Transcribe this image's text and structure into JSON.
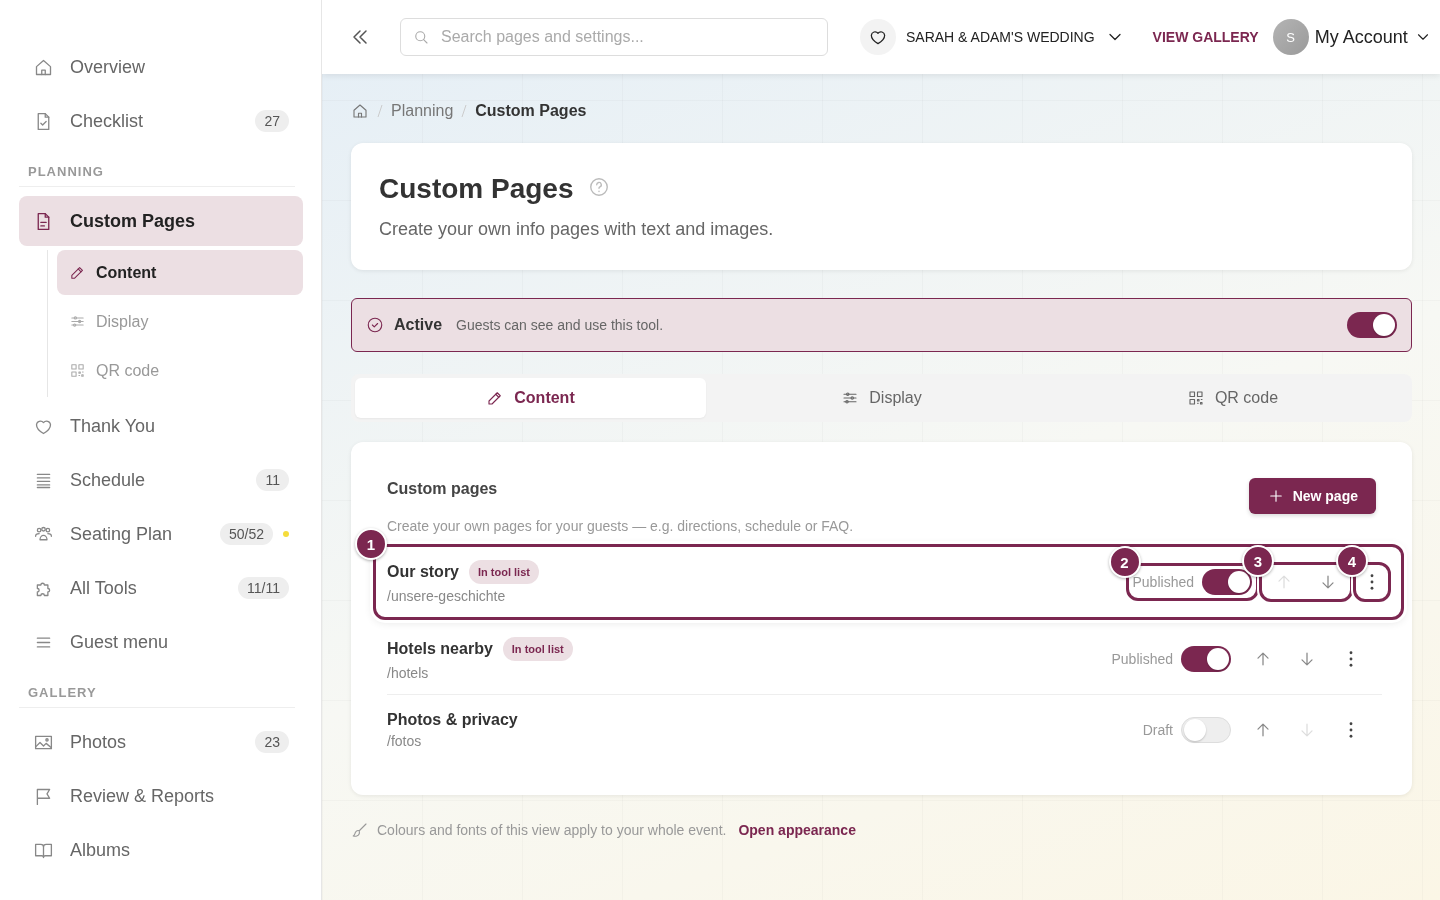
{
  "sidebar": {
    "sections": [
      {
        "items": [
          {
            "label": "Overview",
            "selected": false
          },
          {
            "label": "Checklist",
            "badge": "27",
            "selected": false
          }
        ]
      },
      {
        "heading": "PLANNING",
        "items": [
          {
            "label": "Custom Pages",
            "selected": true,
            "children": [
              {
                "label": "Content",
                "selected": true
              },
              {
                "label": "Display",
                "selected": false
              },
              {
                "label": "QR code",
                "selected": false
              }
            ]
          },
          {
            "label": "Thank You",
            "selected": false
          },
          {
            "label": "Schedule",
            "badge": "11",
            "selected": false
          },
          {
            "label": "Seating Plan",
            "badge": "50/52",
            "color": "#f5dc3c",
            "selected": false
          },
          {
            "label": "All Tools",
            "badge": "11/11",
            "selected": false
          },
          {
            "label": "Guest menu",
            "selected": false
          }
        ]
      },
      {
        "heading": "GALLERY",
        "items": [
          {
            "label": "Photos",
            "badge": "23",
            "selected": false
          },
          {
            "label": "Review & Reports",
            "selected": false
          },
          {
            "label": "Albums",
            "selected": false
          }
        ]
      }
    ]
  },
  "topbar": {
    "search": {
      "placeholder": "Search pages and settings..."
    },
    "event": "SARAH & ADAM'S WEDDING",
    "gallery_link": "VIEW GALLERY",
    "avatar": "S",
    "account": "My Account"
  },
  "breadcrumbs": [
    "Planning",
    "Custom Pages"
  ],
  "header": {
    "title": "Custom Pages",
    "subtitle": "Create your own info pages with text and images."
  },
  "status_banner": {
    "label": "Active",
    "text": "Guests can see and use this tool.",
    "on": true
  },
  "tabs": [
    {
      "label": "Content",
      "selected": true
    },
    {
      "label": "Display",
      "selected": false
    },
    {
      "label": "QR code",
      "selected": false
    }
  ],
  "pages": {
    "title": "Custom pages",
    "description": "Create your own pages for your guests — e.g. directions, schedule or FAQ.",
    "button": "New page",
    "rows": [
      {
        "title": "Our story",
        "tag": "In tool list",
        "slug": "/unsere-geschichte",
        "status": "Published",
        "on": true,
        "up_disabled": true,
        "down_disabled": false,
        "steps": {
          "row": "1",
          "status": "2",
          "move": "3",
          "menu": "4"
        }
      },
      {
        "title": "Hotels nearby",
        "tag": "In tool list",
        "slug": "/hotels",
        "status": "Published",
        "on": true,
        "up_disabled": false,
        "down_disabled": false
      },
      {
        "title": "Photos & privacy",
        "slug": "/fotos",
        "status": "Draft",
        "on": false,
        "up_disabled": false,
        "down_disabled": true
      }
    ]
  },
  "note": {
    "text": "Colours and fonts of this view apply to your whole event.",
    "link": "Open appearance"
  }
}
